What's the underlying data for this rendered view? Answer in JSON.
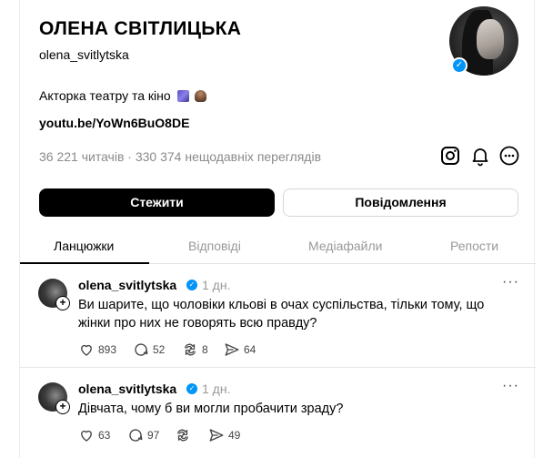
{
  "profile": {
    "name": "ОЛЕНА СВІТЛИЦЬКА",
    "handle": "olena_svitlytska",
    "bio": "Акторка театру та кіно",
    "link": "youtu.be/YoWn6BuO8DE",
    "stats": "36 221 читачів · 330 374 нещодавніх переглядів",
    "verified": true
  },
  "actions": {
    "follow_label": "Стежити",
    "message_label": "Повідомлення"
  },
  "icons": {
    "instagram": "instagram-icon",
    "notifications": "bell-icon",
    "more": "more-icon"
  },
  "tabs": [
    {
      "label": "Ланцюжки",
      "active": true
    },
    {
      "label": "Відповіді",
      "active": false
    },
    {
      "label": "Медіафайли",
      "active": false
    },
    {
      "label": "Репости",
      "active": false
    }
  ],
  "posts": [
    {
      "username": "olena_svitlytska",
      "time": "1 дн.",
      "text": "Ви шарите, що чоловіки кльові в очах суспільства, тільки тому, що жінки про них не говорять всю правду?",
      "likes": "893",
      "comments": "52",
      "reposts": "8",
      "shares": "64"
    },
    {
      "username": "olena_svitlytska",
      "time": "1 дн.",
      "text": "Дівчата, чому б ви могли пробачити зраду?",
      "likes": "63",
      "comments": "97",
      "reposts": "",
      "shares": "49"
    }
  ],
  "colors": {
    "accent": "#000000",
    "verified": "#0095f6",
    "muted": "#999999"
  }
}
